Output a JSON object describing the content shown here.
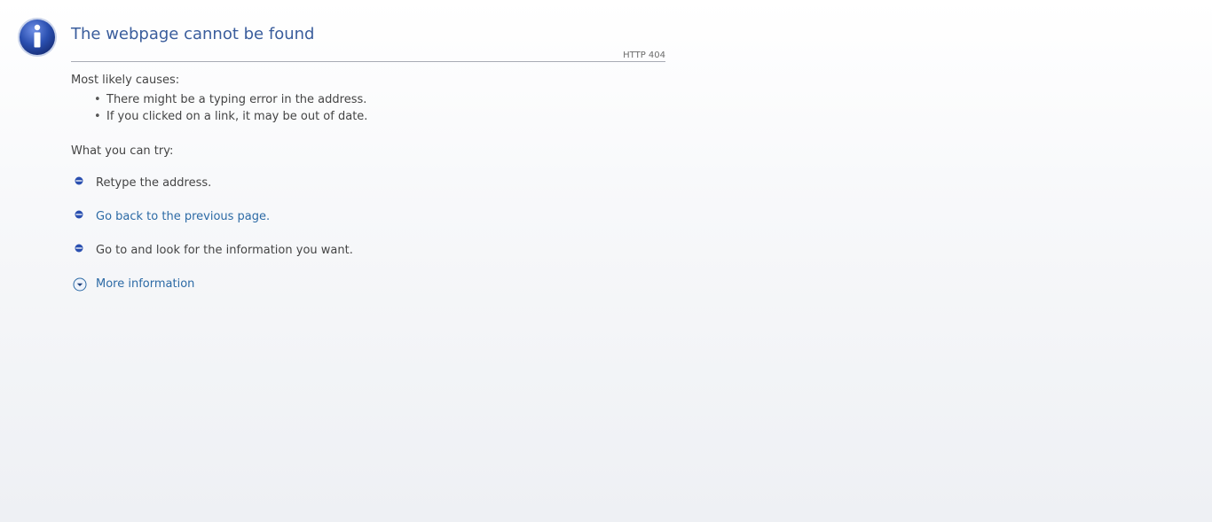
{
  "page": {
    "title": "The webpage cannot be found",
    "http_code": "HTTP 404"
  },
  "causes": {
    "heading": "Most likely causes:",
    "items": [
      "There might be a typing error in the address.",
      "If you clicked on a link, it may be out of date."
    ]
  },
  "try": {
    "heading": "What you can try:",
    "retype": "Retype the address.",
    "go_back": "Go back to the previous page.",
    "go_to": "Go to  and look for the information you want.",
    "more_info": "More information"
  },
  "colors": {
    "title": "#3a5d9c",
    "link": "#2c6aa5",
    "icon_blue": "#2a4fb0"
  },
  "icons": {
    "header": "info-icon",
    "bullets": "blue-bullet-icon",
    "more": "chevron-down-circle-icon"
  }
}
